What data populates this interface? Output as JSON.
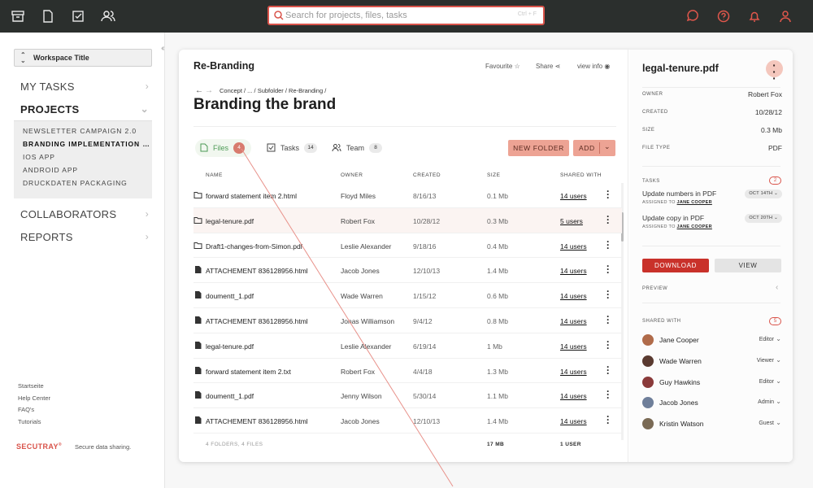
{
  "topbar": {
    "left_icons": [
      "archive-icon",
      "document-icon",
      "checkbox-icon",
      "users-icon"
    ],
    "right_icons": [
      "chat-icon",
      "help-icon",
      "bell-icon",
      "user-icon"
    ],
    "search": {
      "placeholder": "Search for projects, files, tasks",
      "shortcut": "Ctrl + F"
    }
  },
  "sidebar": {
    "workspace": "Workspace Title",
    "sections": {
      "my_tasks": "MY TASKS",
      "projects": "PROJECTS",
      "collaborators": "COLLABORATORS",
      "reports": "REPORTS"
    },
    "projects": [
      "NEWSLETTER CAMPAIGN 2.0",
      "BRANDING IMPLEMENTATION OF ...",
      "IOS APP",
      "ANDROID APP",
      "DRUCKDATEN PACKAGING"
    ],
    "footer_links": [
      "Startseite",
      "Help Center",
      "FAQ's",
      "Tutorials"
    ],
    "brand": "SECUTRAY",
    "brand_mark": "®",
    "tagline": "Secure data sharing."
  },
  "main": {
    "panel_title": "Re-Branding",
    "header_actions": {
      "favourite": "Favourite",
      "share": "Share",
      "view_info": "view info"
    },
    "breadcrumb": "Concept / ... / Subfolder / Re-Branding /",
    "title": "Branding the brand",
    "tabs": [
      {
        "label": "Files",
        "count": "4"
      },
      {
        "label": "Tasks",
        "count": "14"
      },
      {
        "label": "Team",
        "count": "8"
      }
    ],
    "new_folder": "NEW FOLDER",
    "add": "ADD",
    "columns": [
      "NAME",
      "OWNER",
      "CREATED",
      "SIZE",
      "SHARED WITH"
    ],
    "rows": [
      {
        "type": "folder",
        "name": "forward statement item 2.html",
        "owner": "Floyd Miles",
        "created": "8/16/13",
        "size": "0.1 Mb",
        "shared": "14 users"
      },
      {
        "type": "folder",
        "name": "legal-tenure.pdf",
        "owner": "Robert Fox",
        "created": "10/28/12",
        "size": "0.3 Mb",
        "shared": "5 users"
      },
      {
        "type": "folder",
        "name": "Draft1-changes-from-Simon.pdf",
        "owner": "Leslie Alexander",
        "created": "9/18/16",
        "size": "0.4 Mb",
        "shared": "14 users"
      },
      {
        "type": "file",
        "name": "ATTACHEMENT 836128956.html",
        "owner": "Jacob Jones",
        "created": "12/10/13",
        "size": "1.4 Mb",
        "shared": "14 users"
      },
      {
        "type": "file",
        "name": "doumentt_1.pdf",
        "owner": "Wade Warren",
        "created": "1/15/12",
        "size": "0.6 Mb",
        "shared": "14 users"
      },
      {
        "type": "file",
        "name": "ATTACHEMENT 836128956.html",
        "owner": "Jonas Williamson",
        "created": "9/4/12",
        "size": "0.8 Mb",
        "shared": "14 users"
      },
      {
        "type": "file",
        "name": "legal-tenure.pdf",
        "owner": "Leslie Alexander",
        "created": "6/19/14",
        "size": "1 Mb",
        "shared": "14 users"
      },
      {
        "type": "file",
        "name": "forward statement item 2.txt",
        "owner": "Robert Fox",
        "created": "4/4/18",
        "size": "1.3 Mb",
        "shared": "14 users"
      },
      {
        "type": "file",
        "name": "doumentt_1.pdf",
        "owner": "Jenny Wilson",
        "created": "5/30/14",
        "size": "1.1 Mb",
        "shared": "14 users"
      },
      {
        "type": "file",
        "name": "ATTACHEMENT 836128956.html",
        "owner": "Jacob Jones",
        "created": "12/10/13",
        "size": "1.4 Mb",
        "shared": "14 users"
      }
    ],
    "footer": {
      "summary": "4 FOLDERS, 4 FILES",
      "size": "17 MB",
      "users": "1 USER"
    }
  },
  "detail": {
    "title": "legal-tenure.pdf",
    "meta": [
      {
        "k": "OWNER",
        "v": "Robert Fox"
      },
      {
        "k": "CREATED",
        "v": "10/28/12"
      },
      {
        "k": "SIZE",
        "v": "0.3 Mb"
      },
      {
        "k": "FILE TYPE",
        "v": "PDF"
      }
    ],
    "tasks_label": "TASKS",
    "tasks_count": "2",
    "tasks": [
      {
        "title": "Update numbers in PDF",
        "assigned_prefix": "ASSIGNED TO",
        "assignee": "JANE COOPER",
        "date": "OCT 14TH"
      },
      {
        "title": "Update copy in PDF",
        "assigned_prefix": "ASSIGNED TO",
        "assignee": "JANE COOPER",
        "date": "OCT 20TH"
      }
    ],
    "download": "DOWNLOAD",
    "view": "VIEW",
    "preview": "PREVIEW",
    "shared_label": "SHARED WITH",
    "shared_count": "5",
    "people": [
      {
        "name": "Jane Cooper",
        "role": "Editor",
        "color": "#b06b4a"
      },
      {
        "name": "Wade Warren",
        "role": "Viewer",
        "color": "#5a3a30"
      },
      {
        "name": "Guy Hawkins",
        "role": "Editor",
        "color": "#8a3a3a"
      },
      {
        "name": "Jacob Jones",
        "role": "Admin",
        "color": "#6f7f9a"
      },
      {
        "name": "Kristin Watson",
        "role": "Guest",
        "color": "#7a6a55"
      }
    ]
  },
  "colors": {
    "accent": "#d9534a",
    "topbar": "#2b2f2d",
    "button": "#eda394"
  }
}
